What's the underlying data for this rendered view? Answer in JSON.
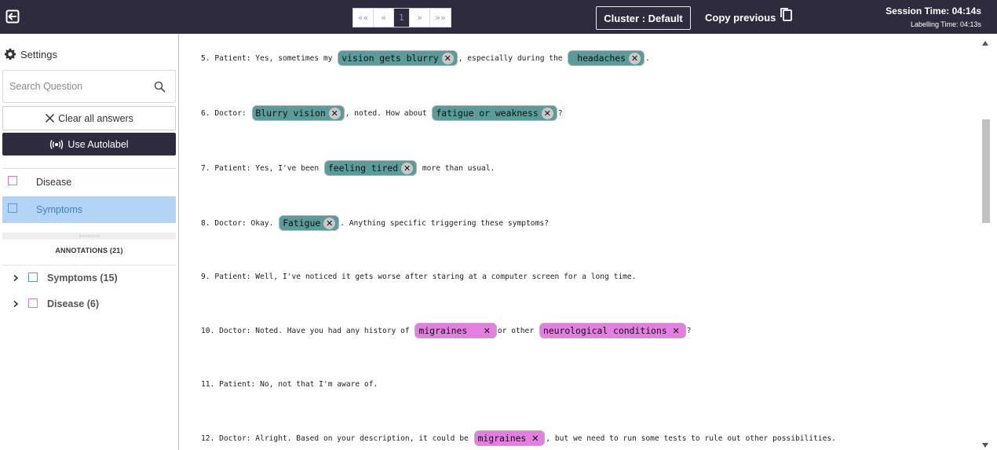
{
  "topbar": {
    "pager": [
      "««",
      "«",
      "1",
      "»",
      "»»"
    ],
    "cluster_label": "Cluster : Default",
    "copy_previous_label": "Copy previous",
    "session_time": "Session Time: 04:14s",
    "labelling_time": "Labelling Time: 04:13s"
  },
  "sidebar": {
    "settings_label": "Settings",
    "search_placeholder": "Search Question",
    "clear_label": "Clear all answers",
    "autolabel_label": "Use Autolabel",
    "labels": [
      {
        "name": "Disease",
        "color": "#d67ec9"
      },
      {
        "name": "Symptoms",
        "color": "#5e9bbf",
        "selected": true
      }
    ],
    "annotations_header": "ANNOTATIONS (21)",
    "annotation_groups": [
      {
        "label": "Symptoms (15)"
      },
      {
        "label": "Disease (6)"
      }
    ]
  },
  "content": {
    "lines": [
      {
        "segments": [
          {
            "t": "5. Patient: Yes, sometimes my "
          },
          {
            "tag": "vision gets blurry",
            "type": "sym"
          },
          {
            "t": ", especially during the "
          },
          {
            "tag": " headaches",
            "type": "sym"
          },
          {
            "t": "."
          }
        ]
      },
      {
        "segments": [
          {
            "t": "6. Doctor: "
          },
          {
            "tag": "Blurry vision",
            "type": "sym"
          },
          {
            "t": ", noted. How about "
          },
          {
            "tag": "fatigue or weakness",
            "type": "sym"
          },
          {
            "t": "?"
          }
        ]
      },
      {
        "segments": [
          {
            "t": "7. Patient: Yes, I've been "
          },
          {
            "tag": "feeling tired",
            "type": "sym"
          },
          {
            "t": " more than usual."
          }
        ]
      },
      {
        "segments": [
          {
            "t": "8. Doctor: Okay. "
          },
          {
            "tag": "Fatigue",
            "type": "sym"
          },
          {
            "t": ". Anything specific triggering these symptoms?"
          }
        ]
      },
      {
        "segments": [
          {
            "t": "9. Patient: Well, I've noticed it gets worse after staring at a computer screen for a long time."
          }
        ]
      },
      {
        "segments": [
          {
            "t": "10. Doctor: Noted. Have you had any history of "
          },
          {
            "tag": "migraines  ",
            "type": "dis"
          },
          {
            "t": "or other "
          },
          {
            "tag": "neurological conditions",
            "type": "dis"
          },
          {
            "t": "?"
          }
        ]
      },
      {
        "segments": [
          {
            "t": "11. Patient: No, not that I'm aware of."
          }
        ]
      },
      {
        "segments": [
          {
            "t": "12. Doctor: Alright. Based on your description, it could be "
          },
          {
            "tag": "migraines",
            "type": "dis"
          },
          {
            "t": ", but we need to run some tests to rule out other possibilities."
          }
        ]
      }
    ]
  },
  "colors": {
    "topbar": "#2d2b3d",
    "symptom_tag": "#5b9c9a",
    "disease_tag": "#e27fe0",
    "selected_label_bg": "#b3d4f5"
  }
}
